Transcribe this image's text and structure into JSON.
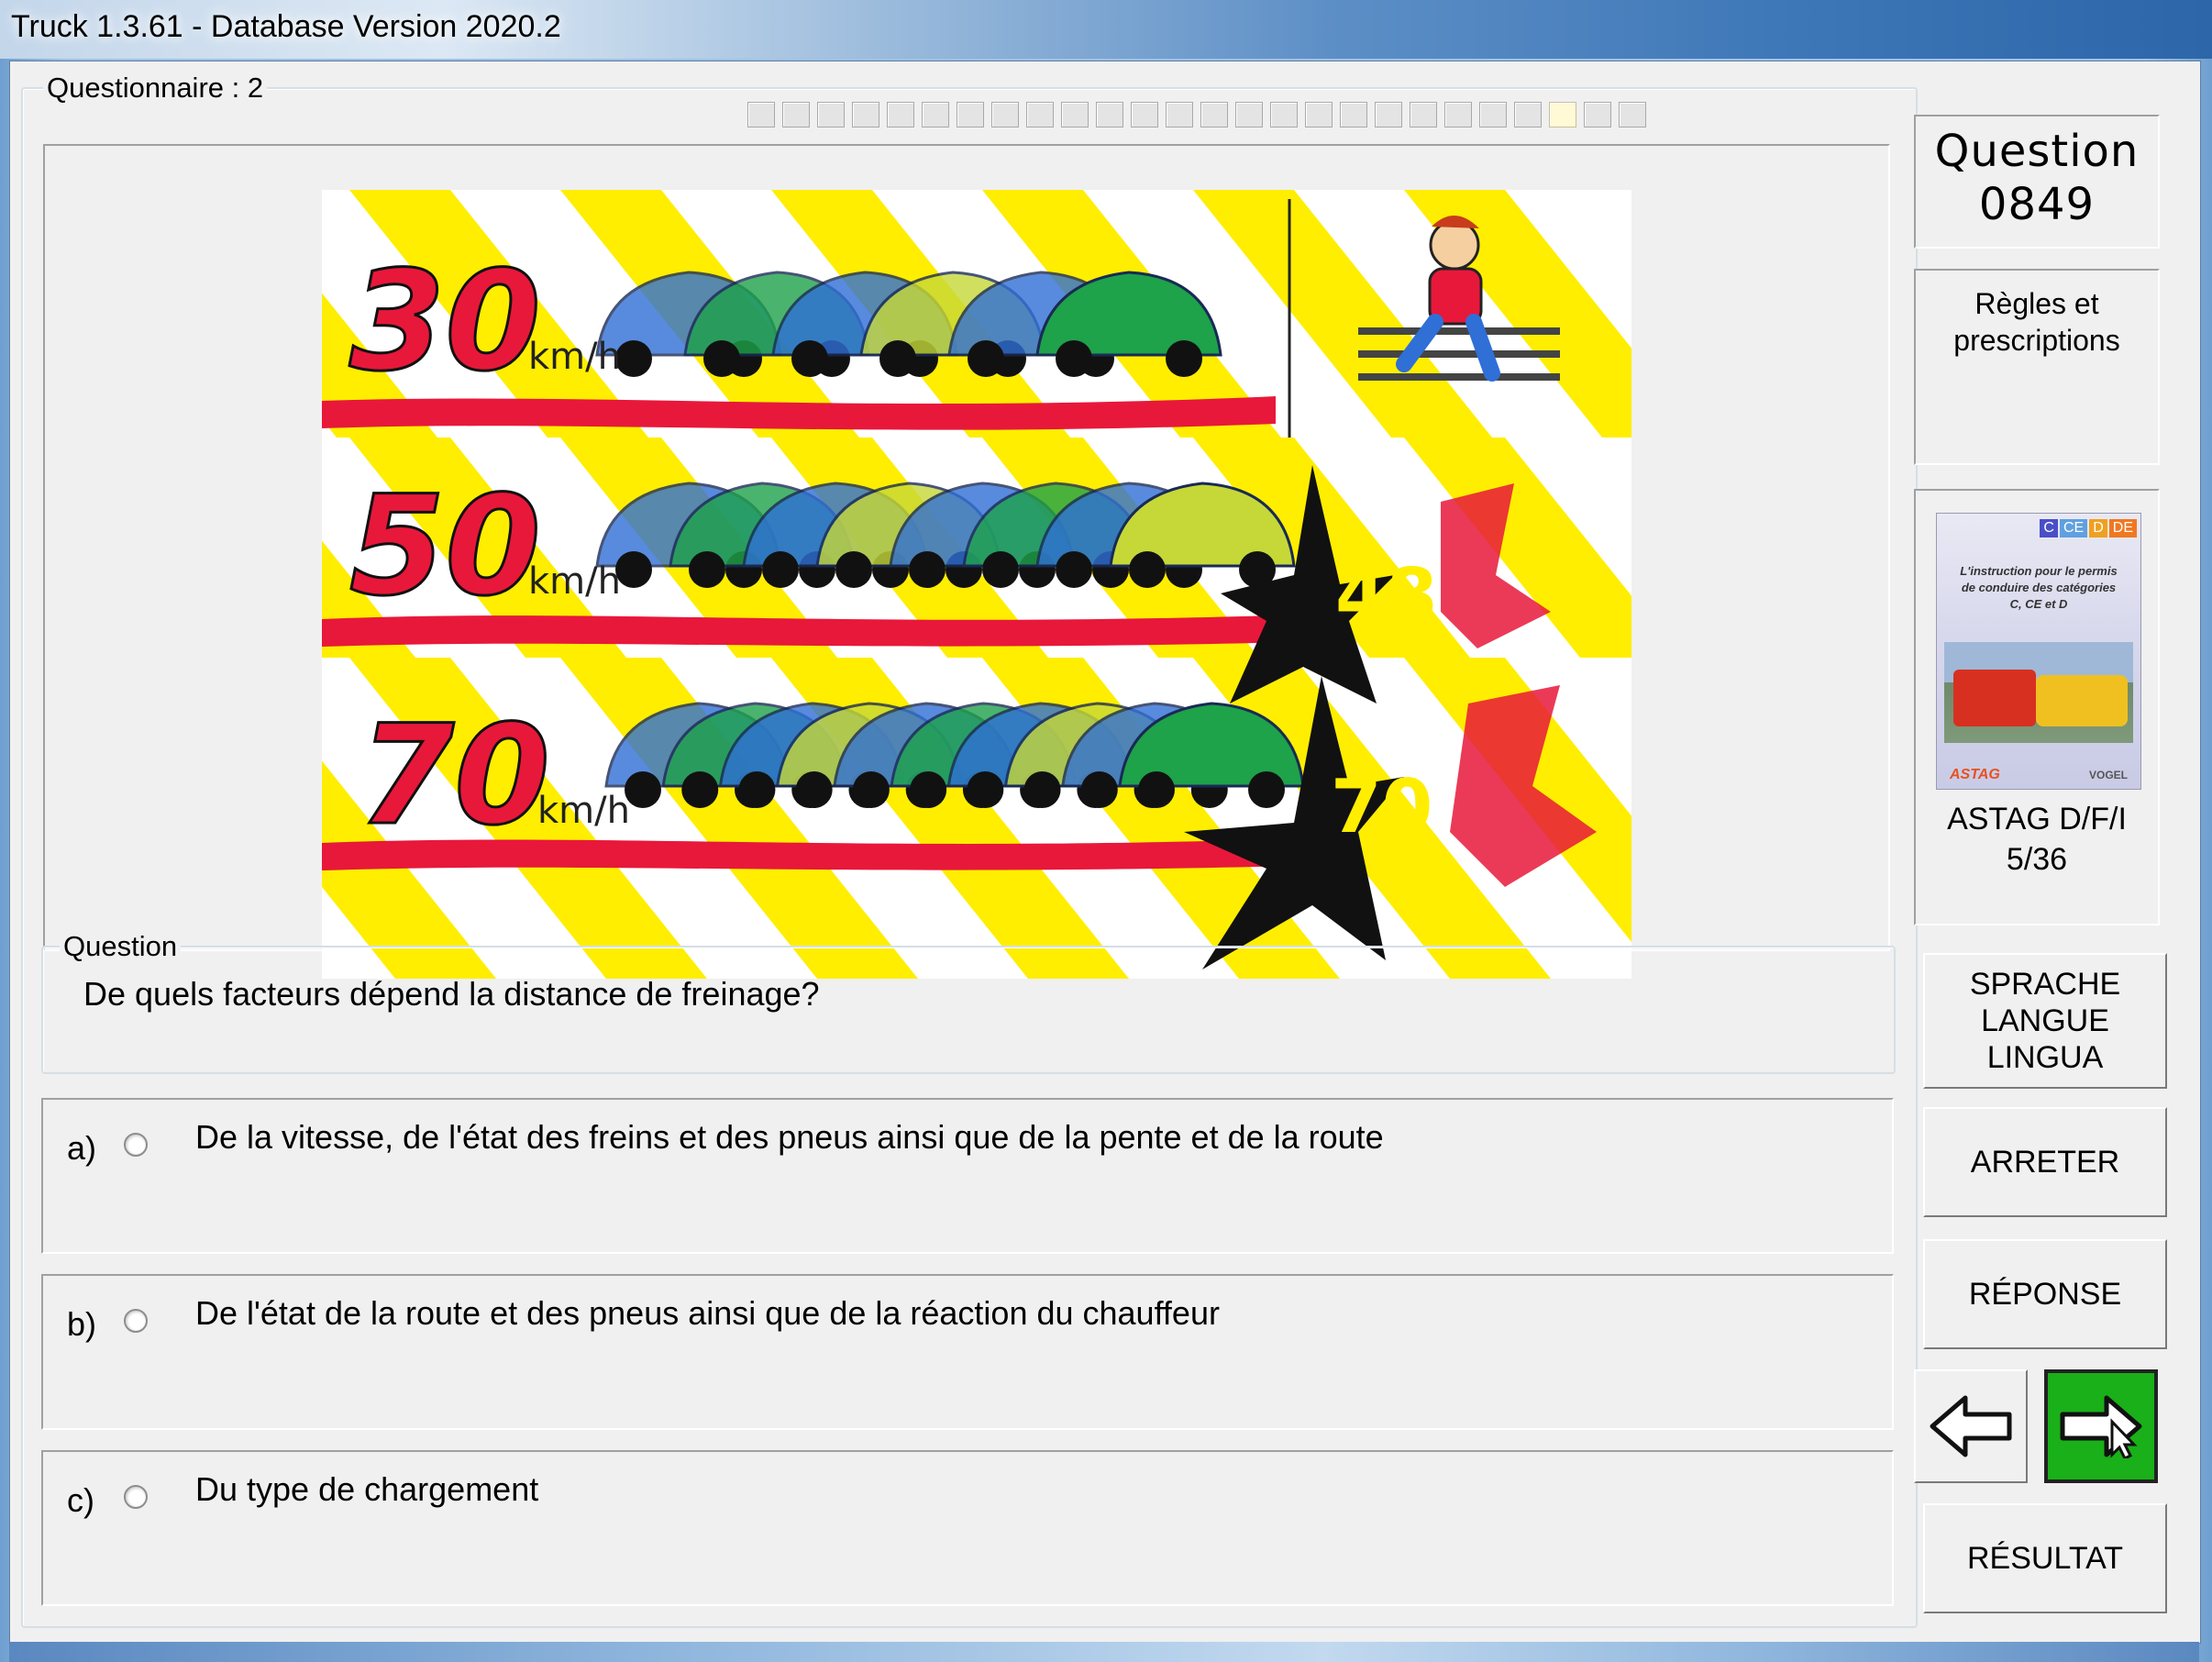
{
  "window": {
    "title": "Truck 1.3.61 - Database Version 2020.2"
  },
  "questionnaire": {
    "label": "Questionnaire : 2",
    "progress_total": 26,
    "progress_current": 24
  },
  "image": {
    "speeds": [
      "30",
      "50",
      "70"
    ],
    "unit": "km/h",
    "impact_speeds": [
      "48",
      "70"
    ]
  },
  "question": {
    "legend": "Question",
    "text": "De quels facteurs dépend la distance de freinage?"
  },
  "answers": [
    {
      "letter": "a)",
      "text": "De la vitesse, de l'état des freins et des pneus ainsi que de la pente et de la route"
    },
    {
      "letter": "b)",
      "text": "De l'état de la route et des pneus ainsi que de la réaction du chauffeur"
    },
    {
      "letter": "c)",
      "text": "Du type de chargement"
    }
  ],
  "side": {
    "question_label": "Question",
    "question_number": "0849",
    "category_line1": "Règles et",
    "category_line2": "prescriptions",
    "book_badges": [
      "C",
      "CE",
      "D",
      "DE"
    ],
    "book_caption": "L'instruction pour le permis de conduire des catégories C, CE et D",
    "book_logo": "ASTAG",
    "book_publisher": "VOGEL",
    "book_source": "ASTAG D/F/I",
    "book_page": "5/36",
    "language_line1": "SPRACHE",
    "language_line2": "LANGUE",
    "language_line3": "LINGUA",
    "stop_label": "ARRETER",
    "answer_label": "RÉPONSE",
    "result_label": "RÉSULTAT",
    "back_icon": "arrow-left-icon",
    "next_icon": "arrow-right-icon"
  },
  "colors": {
    "next_button_bg": "#19b019",
    "speed_red": "#e8183a",
    "stripe_yellow": "#ffee00",
    "car_blue": "#2f6fd6"
  }
}
